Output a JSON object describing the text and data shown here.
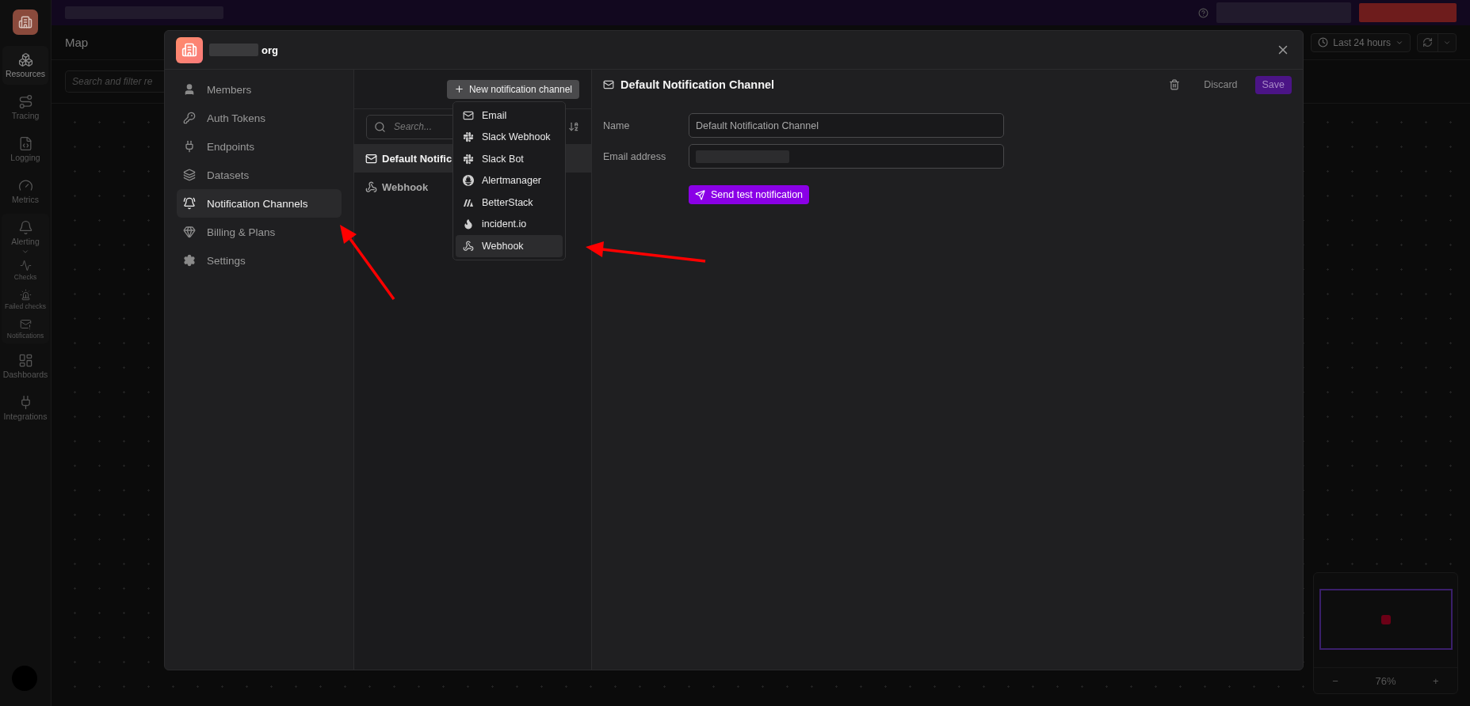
{
  "app_sidebar": {
    "items": [
      {
        "label": "Resources",
        "kind": "resources",
        "selected": true
      },
      {
        "label": "Tracing",
        "kind": "tracing",
        "selected": false
      },
      {
        "label": "Logging",
        "kind": "logging",
        "selected": false
      },
      {
        "label": "Metrics",
        "kind": "metrics",
        "selected": false
      },
      {
        "label": "Alerting",
        "kind": "alerting",
        "selected": false,
        "expanded": true,
        "children": [
          {
            "label": "Checks",
            "kind": "checks",
            "selected": false
          },
          {
            "label": "Failed checks",
            "kind": "failed",
            "selected": false
          },
          {
            "label": "Notifications",
            "kind": "notifications",
            "selected": false
          }
        ]
      },
      {
        "label": "Dashboards",
        "kind": "dashboards",
        "selected": false
      },
      {
        "label": "Integrations",
        "kind": "integrations",
        "selected": false
      }
    ]
  },
  "map": {
    "title": "Map",
    "search": {
      "placeholder": "Search and filter re"
    }
  },
  "time_range": {
    "label": "Last 24 hours"
  },
  "zoom_controls": {
    "minus": "−",
    "reading": "76%",
    "plus": "+"
  },
  "dialog": {
    "org_name": "org",
    "nav": [
      {
        "label": "Members",
        "kind": "members",
        "selected": false
      },
      {
        "label": "Auth Tokens",
        "kind": "tokens",
        "selected": false
      },
      {
        "label": "Endpoints",
        "kind": "endpoints",
        "selected": false
      },
      {
        "label": "Datasets",
        "kind": "datasets",
        "selected": false
      },
      {
        "label": "Notification Channels",
        "kind": "channels",
        "selected": true
      },
      {
        "label": "Billing & Plans",
        "kind": "billing",
        "selected": false
      },
      {
        "label": "Settings",
        "kind": "settings",
        "selected": false
      }
    ],
    "new_channel_button": "New notification channel",
    "search": {
      "placeholder": "Search..."
    },
    "channels": [
      {
        "label": "Default Notific",
        "kind": "email",
        "selected": true
      },
      {
        "label": "Webhook",
        "kind": "webhook",
        "selected": false
      }
    ],
    "new_channel_menu": [
      {
        "label": "Email",
        "kind": "email",
        "selected": false
      },
      {
        "label": "Slack Webhook",
        "kind": "slack",
        "selected": false
      },
      {
        "label": "Slack Bot",
        "kind": "slack",
        "selected": false
      },
      {
        "label": "Alertmanager",
        "kind": "alertmanager",
        "selected": false
      },
      {
        "label": "BetterStack",
        "kind": "betterstack",
        "selected": false
      },
      {
        "label": "incident.io",
        "kind": "incident",
        "selected": false
      },
      {
        "label": "Webhook",
        "kind": "webhook",
        "selected": true
      }
    ],
    "detail": {
      "title": "Default Notification Channel",
      "discard": "Discard",
      "save": "Save",
      "fields": [
        {
          "label": "Name",
          "value": "Default Notification Channel"
        },
        {
          "label": "Email address"
        }
      ],
      "send_test": "Send test notification"
    }
  }
}
